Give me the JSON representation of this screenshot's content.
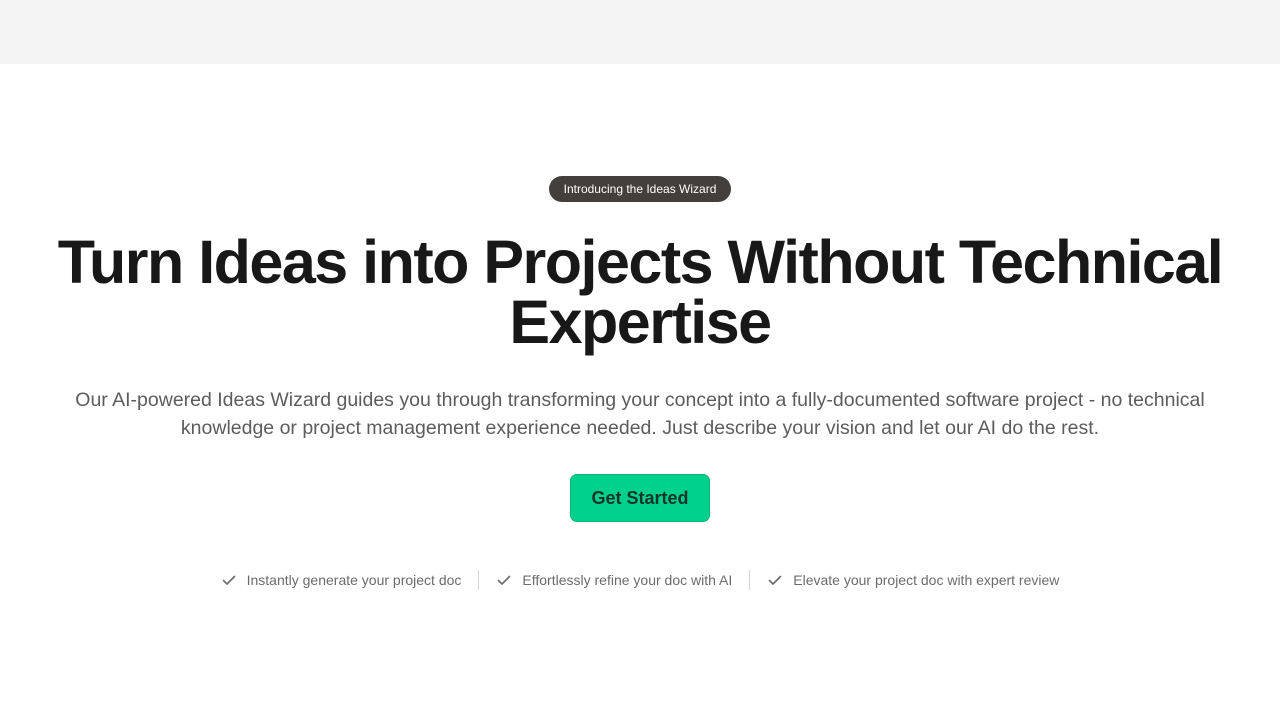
{
  "badge": {
    "label": "Introducing the Ideas Wizard"
  },
  "hero": {
    "headline_line1": "Turn Ideas into Projects Without Technical",
    "headline_line2": "Expertise",
    "subtext_line1": "Our AI-powered Ideas Wizard guides you through transforming your concept into a fully-documented software project - no technical",
    "subtext_line2": "knowledge or project management experience needed. Just describe your vision and let our AI do the rest."
  },
  "cta": {
    "label": "Get Started",
    "color": "#00d18d"
  },
  "features": [
    {
      "icon": "check-icon",
      "label": "Instantly generate your project doc"
    },
    {
      "icon": "check-icon",
      "label": "Effortlessly refine your doc with AI"
    },
    {
      "icon": "check-icon",
      "label": "Elevate your project doc with expert review"
    }
  ]
}
